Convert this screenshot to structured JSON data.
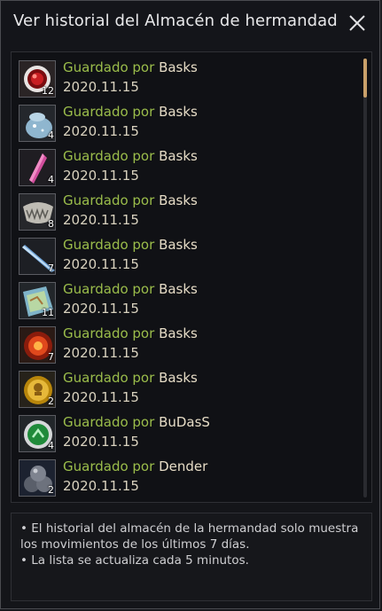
{
  "window": {
    "title": "Ver historial del Almacén de hermandad",
    "close_icon": "close-icon"
  },
  "history": [
    {
      "icon": "red-orb-icon",
      "qty": "12",
      "action": "Guardado por",
      "user": "Basks",
      "date": "2020.11.15"
    },
    {
      "icon": "blue-pouch-icon",
      "qty": "4",
      "action": "Guardado por",
      "user": "Basks",
      "date": "2020.11.15"
    },
    {
      "icon": "pink-crystal-icon",
      "qty": "4",
      "action": "Guardado por",
      "user": "Basks",
      "date": "2020.11.15"
    },
    {
      "icon": "bone-jaw-icon",
      "qty": "8",
      "action": "Guardado por",
      "user": "Basks",
      "date": "2020.11.15"
    },
    {
      "icon": "blue-blade-icon",
      "qty": "7",
      "action": "Guardado por",
      "user": "Basks",
      "date": "2020.11.15"
    },
    {
      "icon": "map-scroll-icon",
      "qty": "11",
      "action": "Guardado por",
      "user": "Basks",
      "date": "2020.11.15"
    },
    {
      "icon": "fire-orb-icon",
      "qty": "7",
      "action": "Guardado por",
      "user": "Basks",
      "date": "2020.11.15"
    },
    {
      "icon": "gold-coin-icon",
      "qty": "2",
      "action": "Guardado por",
      "user": "Basks",
      "date": "2020.11.15"
    },
    {
      "icon": "green-orb-icon",
      "qty": "4",
      "action": "Guardado por",
      "user": "BuDasS",
      "date": "2020.11.15"
    },
    {
      "icon": "iron-balls-icon",
      "qty": "2",
      "action": "Guardado por",
      "user": "Dender",
      "date": "2020.11.15"
    }
  ],
  "info": {
    "note1": "• El historial del almacén de la hermandad solo muestra los movimientos de los últimos 7 días.",
    "note2": "• La lista se actualiza cada 5 minutos."
  },
  "colors": {
    "saved_by": "#9bbd4b",
    "username": "#e6dcc6",
    "scroll_thumb": "#c9a06a"
  }
}
